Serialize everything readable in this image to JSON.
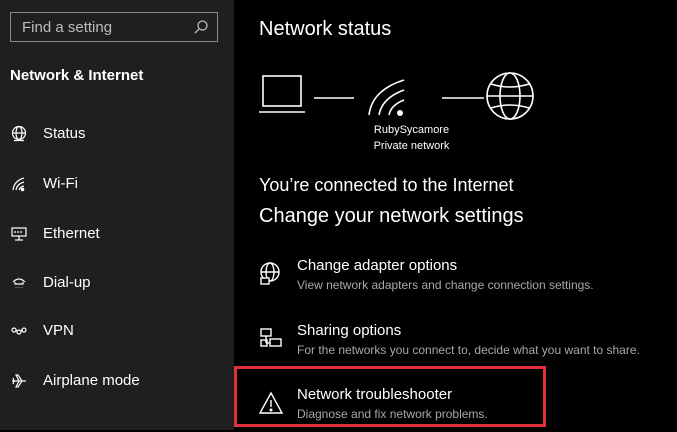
{
  "search": {
    "placeholder": "Find a setting",
    "icon": "search-icon"
  },
  "sidebar": {
    "section_title": "Network & Internet",
    "items": [
      {
        "label": "Status",
        "icon": "globe-status-icon"
      },
      {
        "label": "Wi-Fi",
        "icon": "wifi-icon"
      },
      {
        "label": "Ethernet",
        "icon": "ethernet-icon"
      },
      {
        "label": "Dial-up",
        "icon": "dialup-icon"
      },
      {
        "label": "VPN",
        "icon": "vpn-icon"
      },
      {
        "label": "Airplane mode",
        "icon": "airplane-icon"
      }
    ]
  },
  "main": {
    "title": "Network status",
    "network_name": "RubySycamore",
    "network_type": "Private network",
    "connection_status": "You’re connected to the Internet",
    "change_heading": "Change your network settings",
    "options": [
      {
        "title": "Change adapter options",
        "desc": "View network adapters and change connection settings.",
        "icon": "adapter-icon"
      },
      {
        "title": "Sharing options",
        "desc": "For the networks you connect to, decide what you want to share.",
        "icon": "sharing-icon"
      },
      {
        "title": "Network troubleshooter",
        "desc": "Diagnose and fix network problems.",
        "icon": "warning-icon"
      }
    ]
  },
  "colors": {
    "highlight": "#e0303b",
    "sidebar_bg": "#1f1f1f",
    "main_bg": "#000000"
  }
}
